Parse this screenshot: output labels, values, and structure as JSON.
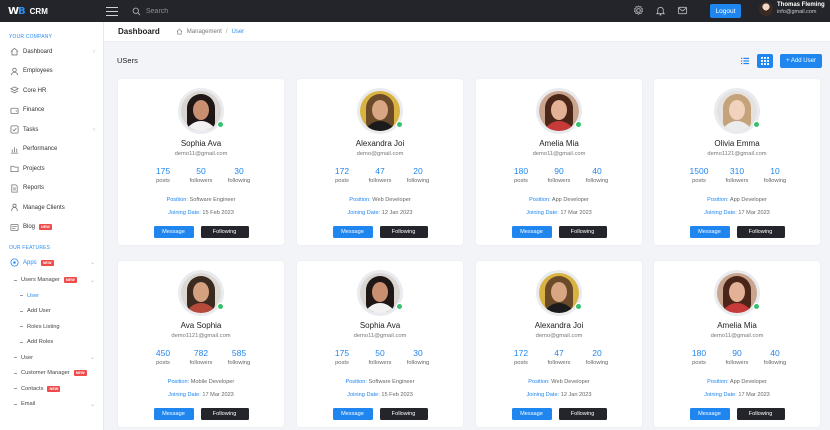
{
  "brand": {
    "logo": "W",
    "logo_accent": "B",
    "name": "CRM"
  },
  "search": {
    "placeholder": "Search"
  },
  "topbar": {
    "logout_label": "Logout",
    "user_name": "Thomas Fleming",
    "user_email": "info@gmail.com",
    "icons": [
      "gear-icon",
      "bell-icon",
      "mail-icon"
    ]
  },
  "sidebar": {
    "section_company": "YOUR COMPANY",
    "items": [
      {
        "label": "Dashboard",
        "icon": "home-icon",
        "chevron": true
      },
      {
        "label": "Employees",
        "icon": "user-icon",
        "chevron": false
      },
      {
        "label": "Core HR",
        "icon": "layers-icon",
        "chevron": false
      },
      {
        "label": "Finance",
        "icon": "wallet-icon",
        "chevron": false
      },
      {
        "label": "Tasks",
        "icon": "check-icon",
        "chevron": true
      },
      {
        "label": "Performance",
        "icon": "chart-icon",
        "chevron": false
      },
      {
        "label": "Projects",
        "icon": "folder-icon",
        "chevron": false
      },
      {
        "label": "Reports",
        "icon": "doc-icon",
        "chevron": false
      },
      {
        "label": "Manage Clients",
        "icon": "person-icon",
        "chevron": false
      },
      {
        "label": "Blog",
        "icon": "blog-icon",
        "badge": "NEW",
        "chevron": false
      }
    ],
    "section_features": "OUR FEATURES",
    "apps": {
      "label": "Apps",
      "badge": "NEW"
    },
    "subitems": [
      {
        "label": "Users Manager",
        "badge": "NEW",
        "chevron": true,
        "active": false
      },
      {
        "label": "User",
        "active": true
      },
      {
        "label": "Add User",
        "active": false
      },
      {
        "label": "Roles Listing",
        "active": false
      },
      {
        "label": "Add Roles",
        "active": false
      },
      {
        "label": "User",
        "chevron": true,
        "active": false
      },
      {
        "label": "Customer Manager",
        "badge": "NEW",
        "active": false
      },
      {
        "label": "Contacts",
        "badge": "NEW",
        "active": false
      },
      {
        "label": "Email",
        "chevron": true,
        "active": false
      }
    ]
  },
  "header": {
    "title": "Dashboard",
    "crumb_home": "Management",
    "crumb_sep": "/",
    "crumb_current": "User"
  },
  "content": {
    "title": "USers",
    "add_user_label": "+ Add User"
  },
  "labels": {
    "posts": "posts",
    "followers": "followers",
    "following": "following",
    "position": "Position:",
    "joining": "Joining Date:",
    "message": "Message",
    "following_btn": "Following"
  },
  "users": [
    {
      "name": "Sophia Ava",
      "email": "demo11@gmail.com",
      "posts": "175",
      "followers": "50",
      "following": "30",
      "position": "Software Engineer",
      "joining": "15 Feb 2023",
      "hair": "#1e1716",
      "skin": "#c98f70",
      "body": "#f2f2f2",
      "bg": "#d9d6d2"
    },
    {
      "name": "Alexandra Joi",
      "email": "demo@gmail.com",
      "posts": "172",
      "followers": "47",
      "following": "20",
      "position": "Web Developer",
      "joining": "12 Jan 2023",
      "hair": "#6b4a2a",
      "skin": "#d8a682",
      "body": "#1b1b1b",
      "bg": "#d9b341"
    },
    {
      "name": "Amelia Mia",
      "email": "demo11@gmail.com",
      "posts": "180",
      "followers": "90",
      "following": "40",
      "position": "App Developer",
      "joining": "17 Mar 2023",
      "hair": "#4a2618",
      "skin": "#e3b296",
      "body": "#c73a3a",
      "bg": "#c9a48e"
    },
    {
      "name": "Olivia Emma",
      "email": "demo1121@gmail.com",
      "posts": "1500",
      "followers": "310",
      "following": "10",
      "position": "App Developer",
      "joining": "17 Mar 2023",
      "hair": "#c4a27a",
      "skin": "#f1d2bd",
      "body": "#ececec",
      "bg": "#e4e1de"
    },
    {
      "name": "Ava Sophia",
      "email": "demo1121@gmail.com",
      "posts": "450",
      "followers": "782",
      "following": "585",
      "position": "Mobile Developer",
      "joining": "17 Mar 2023",
      "hair": "#3a2a20",
      "skin": "#d3a080",
      "body": "#b54a3a",
      "bg": "#dcd8d2"
    },
    {
      "name": "Sophia Ava",
      "email": "demo11@gmail.com",
      "posts": "175",
      "followers": "50",
      "following": "30",
      "position": "Software Engineer",
      "joining": "15 Feb 2023",
      "hair": "#1e1716",
      "skin": "#c98f70",
      "body": "#f2f2f2",
      "bg": "#d9d6d2"
    },
    {
      "name": "Alexandra Joi",
      "email": "demo@gmail.com",
      "posts": "172",
      "followers": "47",
      "following": "20",
      "position": "Web Developer",
      "joining": "12 Jan 2023",
      "hair": "#6b4a2a",
      "skin": "#d8a682",
      "body": "#1b1b1b",
      "bg": "#d9b341"
    },
    {
      "name": "Amelia Mia",
      "email": "demo11@gmail.com",
      "posts": "180",
      "followers": "90",
      "following": "40",
      "position": "App Developer",
      "joining": "17 Mar 2023",
      "hair": "#4a2618",
      "skin": "#e3b296",
      "body": "#c73a3a",
      "bg": "#c9a48e"
    }
  ],
  "colors": {
    "accent": "#1f86ef",
    "topbar": "#24252a",
    "online": "#38c06f",
    "badge": "#ef4b4b"
  }
}
